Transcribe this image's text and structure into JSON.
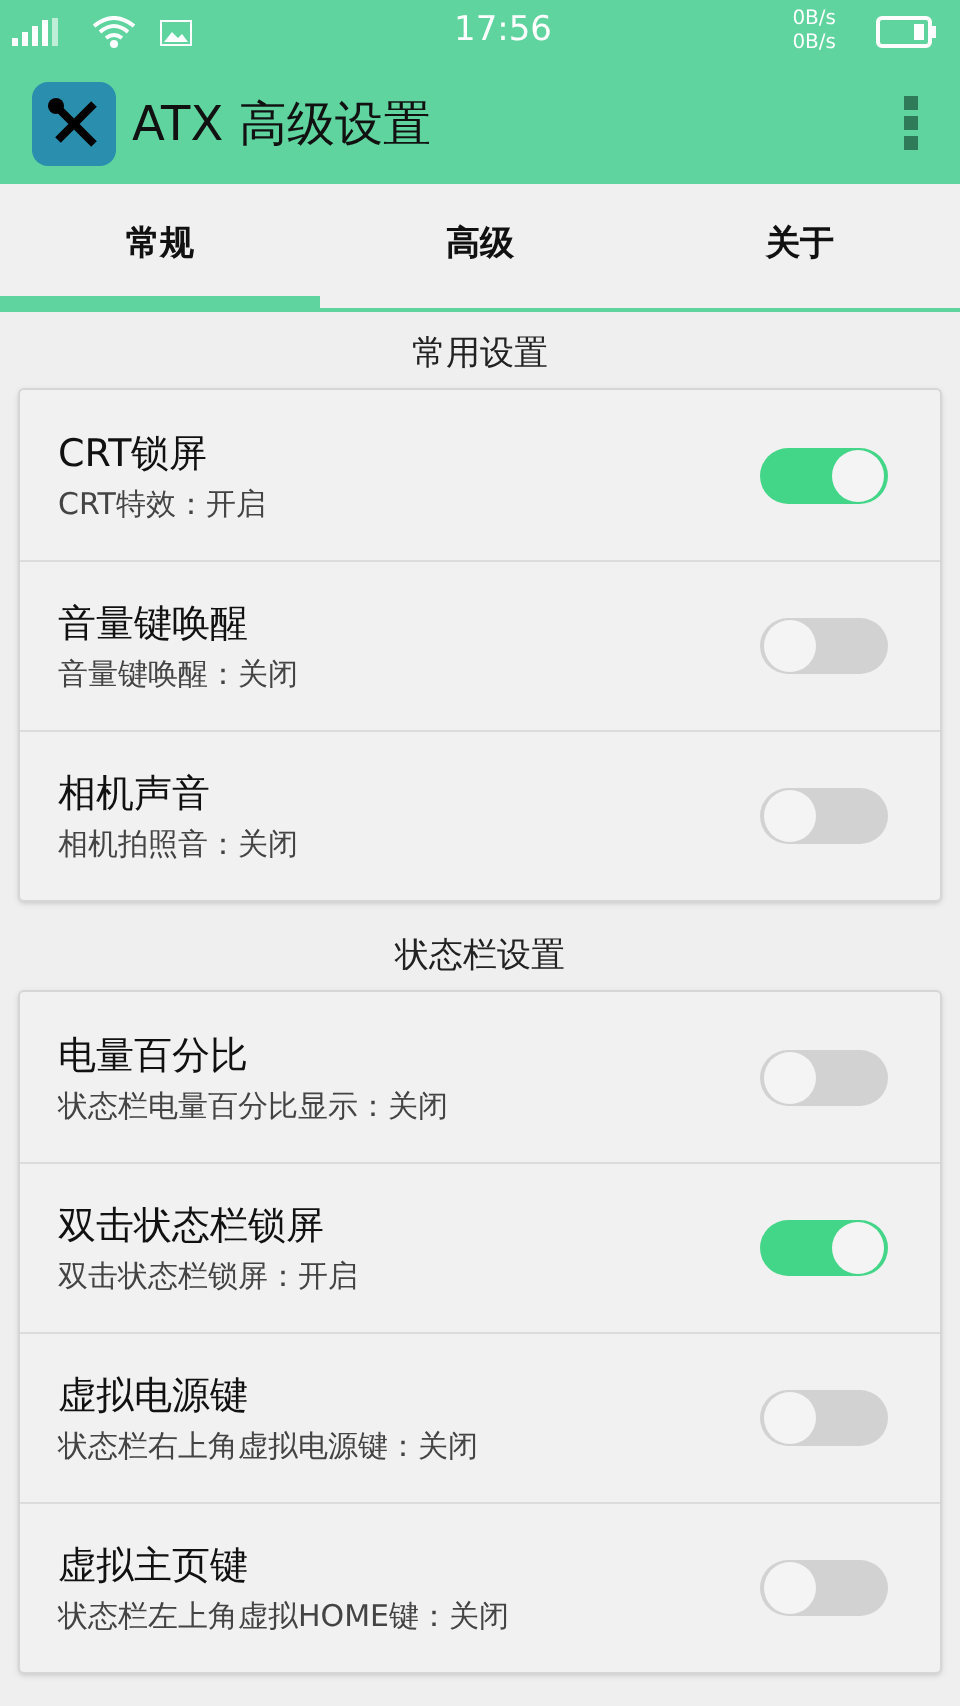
{
  "status_bar": {
    "time": "17:56",
    "net_up": "0B/s",
    "net_down": "0B/s"
  },
  "app_bar": {
    "title": "ATX 高级设置"
  },
  "tabs": [
    {
      "label": "常规",
      "selected": true
    },
    {
      "label": "高级",
      "selected": false
    },
    {
      "label": "关于",
      "selected": false
    }
  ],
  "sections": [
    {
      "title": "常用设置",
      "items": [
        {
          "title": "CRT锁屏",
          "subtitle": "CRT特效：开启",
          "on": true
        },
        {
          "title": "音量键唤醒",
          "subtitle": "音量键唤醒：关闭",
          "on": false
        },
        {
          "title": "相机声音",
          "subtitle": "相机拍照音：关闭",
          "on": false
        }
      ]
    },
    {
      "title": "状态栏设置",
      "items": [
        {
          "title": "电量百分比",
          "subtitle": "状态栏电量百分比显示：关闭",
          "on": false
        },
        {
          "title": "双击状态栏锁屏",
          "subtitle": "双击状态栏锁屏：开启",
          "on": true
        },
        {
          "title": "虚拟电源键",
          "subtitle": "状态栏右上角虚拟电源键：关闭",
          "on": false
        },
        {
          "title": "虚拟主页键",
          "subtitle": "状态栏左上角虚拟HOME键：关闭",
          "on": false
        }
      ]
    }
  ]
}
